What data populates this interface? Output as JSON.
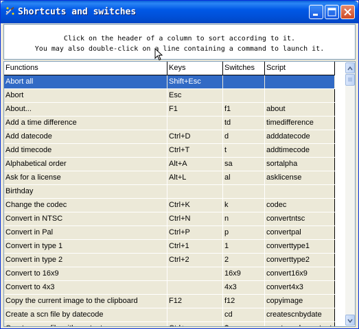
{
  "window": {
    "title": "Shortcuts and switches",
    "controls": [
      "minimize-icon",
      "maximize-icon",
      "close-icon"
    ]
  },
  "info": {
    "line1": "Click on the header of a column to sort according to it.",
    "line2": "You may also double-click on a line containing a command to launch it."
  },
  "table": {
    "columns": [
      "Functions",
      "Keys",
      "Switches",
      "Script"
    ],
    "selected_row": 0,
    "rows": [
      [
        "Abort all",
        "Shift+Esc",
        "",
        ""
      ],
      [
        "Abort",
        "Esc",
        "",
        ""
      ],
      [
        "About...",
        "F1",
        "f1",
        "about"
      ],
      [
        "Add a time difference",
        "",
        "td",
        "timedifference"
      ],
      [
        "Add datecode",
        "Ctrl+D",
        "d",
        "adddatecode"
      ],
      [
        "Add timecode",
        "Ctrl+T",
        "t",
        "addtimecode"
      ],
      [
        "Alphabetical order",
        "Alt+A",
        "sa",
        "sortalpha"
      ],
      [
        "Ask for a license",
        "Alt+L",
        "al",
        "asklicense"
      ],
      [
        "Birthday",
        "",
        "",
        ""
      ],
      [
        "Change the codec",
        "Ctrl+K",
        "k",
        "codec"
      ],
      [
        "Convert in NTSC",
        "Ctrl+N",
        "n",
        "convertntsc"
      ],
      [
        "Convert in Pal",
        "Ctrl+P",
        "p",
        "convertpal"
      ],
      [
        "Convert in type 1",
        "Ctrl+1",
        "1",
        "converttype1"
      ],
      [
        "Convert in type 2",
        "Ctrl+2",
        "2",
        "converttype2"
      ],
      [
        "Convert to 16x9",
        "",
        "16x9",
        "convert16x9"
      ],
      [
        "Convert to 4x3",
        "",
        "4x3",
        "convert4x3"
      ],
      [
        "Copy the current image to the clipboard",
        "F12",
        "f12",
        "copyimage"
      ],
      [
        "Create a scn file by datecode",
        "",
        "cd",
        "createscnbydate"
      ],
      [
        "Create a scn file with content",
        "Ctrl+;",
        "$",
        "createscnbycontent"
      ]
    ]
  },
  "colors": {
    "titlebar": "#0058e6",
    "selection": "#316ac5",
    "row_background": "#ece9d8",
    "window_background": "#ece9d8"
  }
}
